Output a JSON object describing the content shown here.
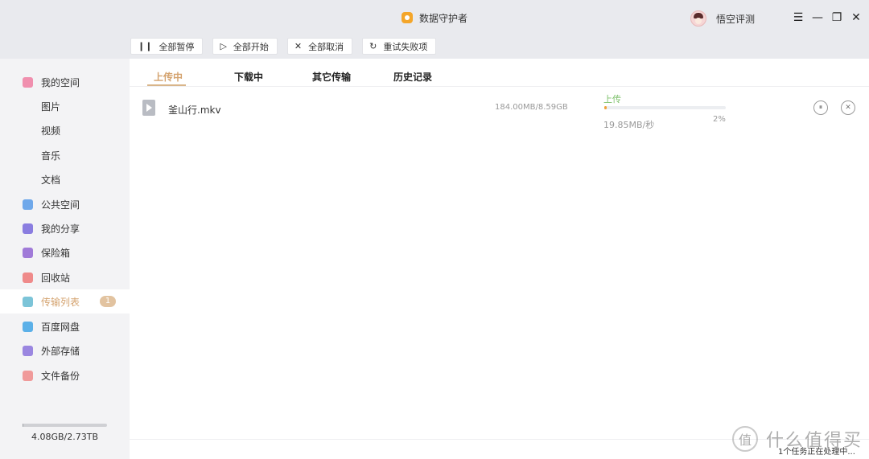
{
  "window": {
    "title": "数据守护者",
    "user_name": "悟空评测",
    "controls": [
      "☰",
      "—",
      "❐",
      "✕"
    ]
  },
  "toolbar": {
    "pause_all": "全部暂停",
    "start_all": "全部开始",
    "cancel_all": "全部取消",
    "retry_failed": "重试失败项"
  },
  "sidebar": {
    "items": [
      {
        "label": "我的空间",
        "icon": "folder-icon",
        "color": "#f08fae"
      },
      {
        "label": "图片"
      },
      {
        "label": "视频"
      },
      {
        "label": "音乐"
      },
      {
        "label": "文档"
      },
      {
        "label": "公共空间",
        "icon": "send-icon",
        "color": "#6fa8ea"
      },
      {
        "label": "我的分享",
        "icon": "share-icon",
        "color": "#8a7de0"
      },
      {
        "label": "保险箱",
        "icon": "safe-icon",
        "color": "#a07ad8"
      },
      {
        "label": "回收站",
        "icon": "trash-icon",
        "color": "#ef8a8a"
      },
      {
        "label": "传输列表",
        "icon": "transfer-icon",
        "color": "#7cc4d8",
        "badge": "1"
      },
      {
        "label": "百度网盘",
        "icon": "cloud-icon",
        "color": "#5bb0e8"
      },
      {
        "label": "外部存储",
        "icon": "usb-icon",
        "color": "#9a86e0"
      },
      {
        "label": "文件备份",
        "icon": "backup-icon",
        "color": "#f09a9a"
      }
    ],
    "storage_text": "4.08GB/2.73TB",
    "storage_fraction": 0.0015
  },
  "tabs": [
    "上传中",
    "下载中",
    "其它传输",
    "历史记录"
  ],
  "transfer": {
    "file_name": "釜山行.mkv",
    "size": "184.00MB/8.59GB",
    "status": "上传",
    "speed": "19.85MB/秒",
    "percent": "2%",
    "progress": 0.02,
    "pause_icon": "⏸",
    "cancel_icon": "✕"
  },
  "footer": {
    "status": "1个任务正在处理中..."
  },
  "watermark": {
    "symbol": "值",
    "text": "什么值得买"
  }
}
